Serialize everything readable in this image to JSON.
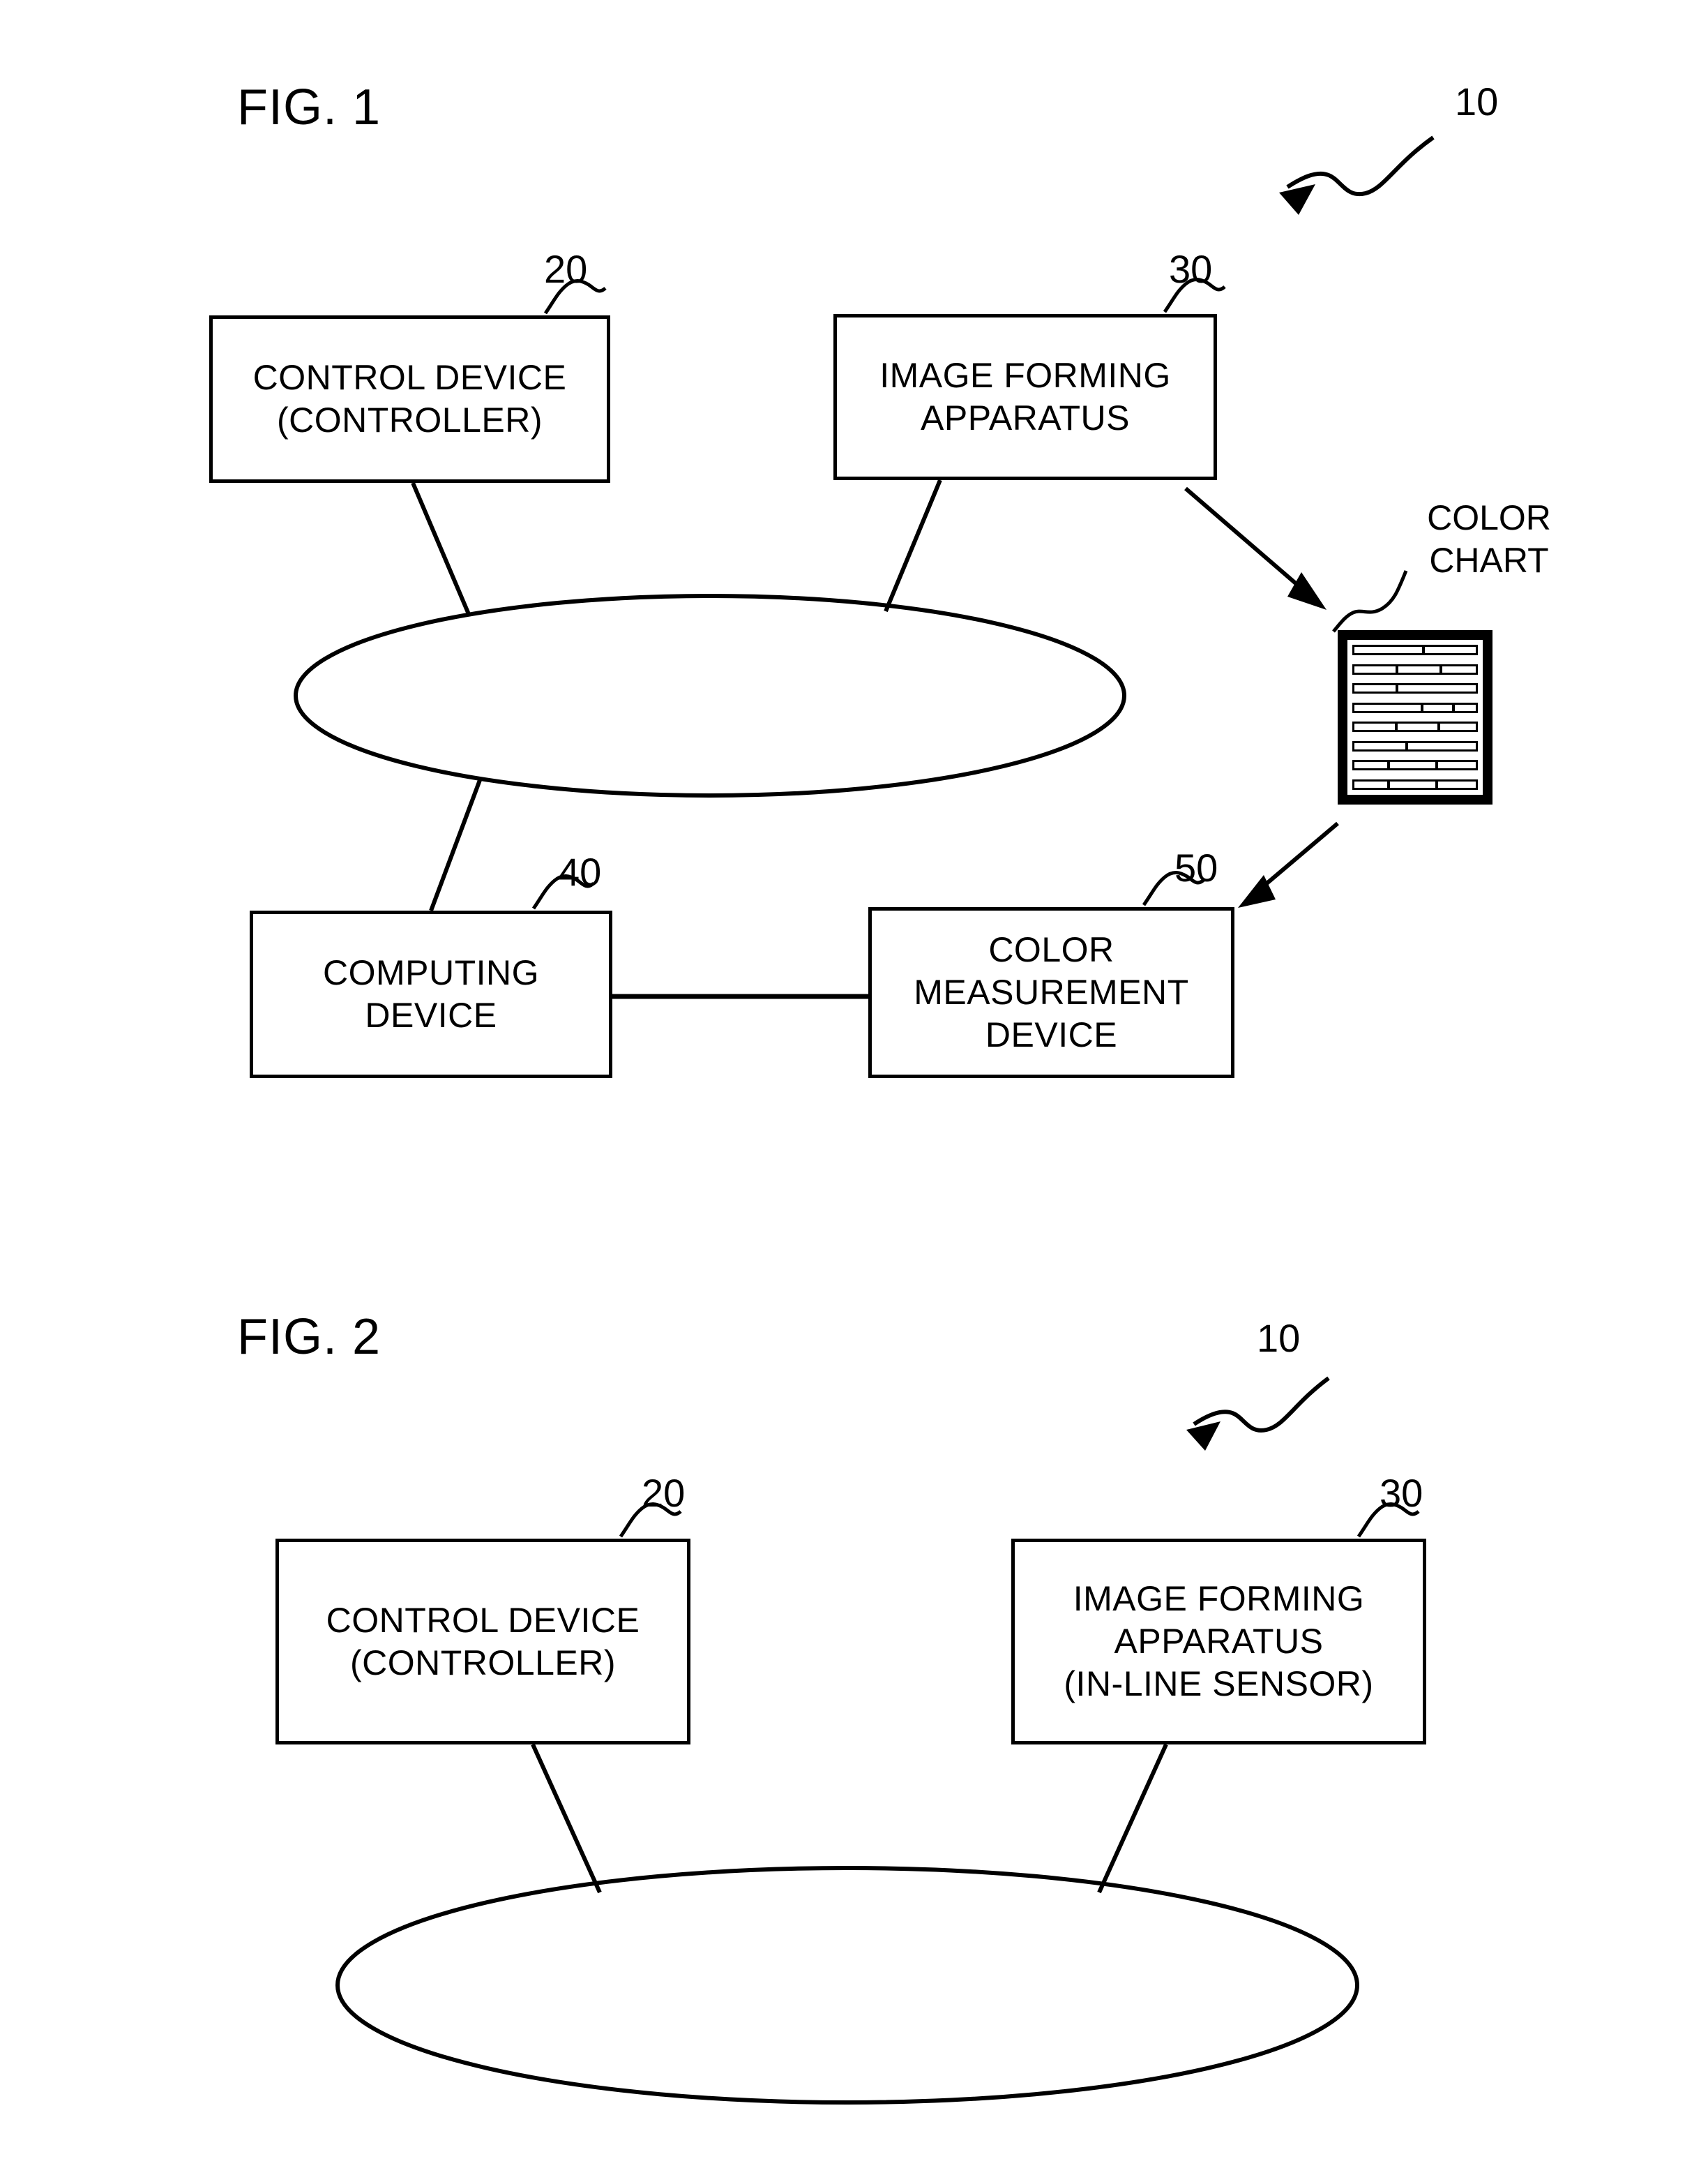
{
  "figures": [
    {
      "title": "FIG. 1",
      "system_ref": "10",
      "blocks": [
        {
          "ref": "20",
          "text": "CONTROL DEVICE\n(CONTROLLER)"
        },
        {
          "ref": "30",
          "text": "IMAGE FORMING\nAPPARATUS"
        },
        {
          "ref": "40",
          "text": "COMPUTING\nDEVICE"
        },
        {
          "ref": "50",
          "text": "COLOR\nMEASUREMENT\nDEVICE"
        }
      ],
      "labels": [
        {
          "name": "color-chart",
          "text": "COLOR\nCHART"
        }
      ],
      "network_node": {
        "shape": "ellipse",
        "text": ""
      }
    },
    {
      "title": "FIG. 2",
      "system_ref": "10",
      "blocks": [
        {
          "ref": "20",
          "text": "CONTROL DEVICE\n(CONTROLLER)"
        },
        {
          "ref": "30",
          "text": "IMAGE FORMING\nAPPARATUS\n(IN-LINE SENSOR)"
        }
      ],
      "labels": [],
      "network_node": {
        "shape": "ellipse",
        "text": ""
      }
    }
  ],
  "color_chart": {
    "rows": [
      [
        56,
        42
      ],
      [
        34,
        34,
        28
      ],
      [
        34,
        64
      ],
      [
        56,
        24,
        18
      ],
      [
        34,
        34,
        30
      ],
      [
        42,
        56
      ],
      [
        28,
        38,
        32
      ],
      [
        28,
        38,
        32
      ]
    ]
  },
  "style": {
    "ink": "#000000",
    "paper": "#ffffff"
  }
}
